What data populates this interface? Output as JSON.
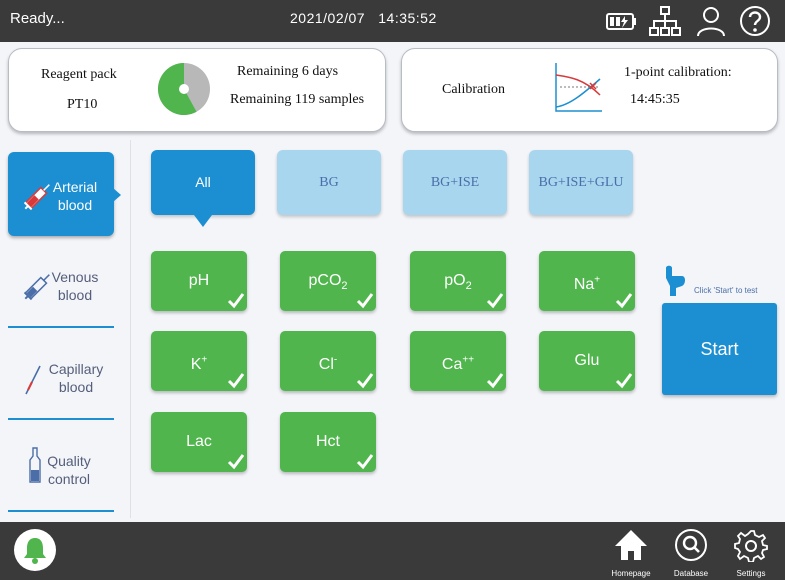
{
  "topbar": {
    "status": "Ready...",
    "date": "2021/02/07",
    "time": "14:35:52"
  },
  "reagent": {
    "label": "Reagent pack",
    "pack": "PT10",
    "days": "Remaining 6 days",
    "samples": "Remaining 119 samples",
    "fraction": 0.58,
    "colors": {
      "used": "#b8b8b8",
      "remaining": "#4fb54c"
    }
  },
  "calibration": {
    "label": "Calibration",
    "type": "1-point calibration:",
    "time": "14:45:35"
  },
  "sidebar": {
    "items": [
      {
        "label_1": "Arterial",
        "label_2": "blood",
        "icon": "syringe-icon"
      },
      {
        "label_1": "Venous",
        "label_2": "blood",
        "icon": "syringe-icon"
      },
      {
        "label_1": "Capillary",
        "label_2": "blood",
        "icon": "capillary-tube-icon"
      },
      {
        "label_1": "Quality",
        "label_2": "control",
        "icon": "ampoule-icon"
      }
    ]
  },
  "tabs": [
    "All",
    "BG",
    "BG+ISE",
    "BG+ISE+GLU"
  ],
  "params": {
    "pH": "pH",
    "pCO2_base": "pCO",
    "pCO2_sub": "2",
    "pO2_base": "pO",
    "pO2_sub": "2",
    "Na_base": "Na",
    "Na_sup": "+",
    "K_base": "K",
    "K_sup": "+",
    "Cl_base": "Cl",
    "Cl_sup": "-",
    "Ca_base": "Ca",
    "Ca_sup": "++",
    "Glu": "Glu",
    "Lac": "Lac",
    "Hct": "Hct"
  },
  "start": {
    "label": "Start",
    "hint": "Click 'Start' to test"
  },
  "bottombar": {
    "homepage": "Homepage",
    "database": "Database",
    "settings": "Settings"
  },
  "colors": {
    "accent": "#1b8fd1",
    "tile_green": "#4fb54c",
    "tab_light": "#a8d6ef",
    "bar": "#3a3a3a"
  }
}
